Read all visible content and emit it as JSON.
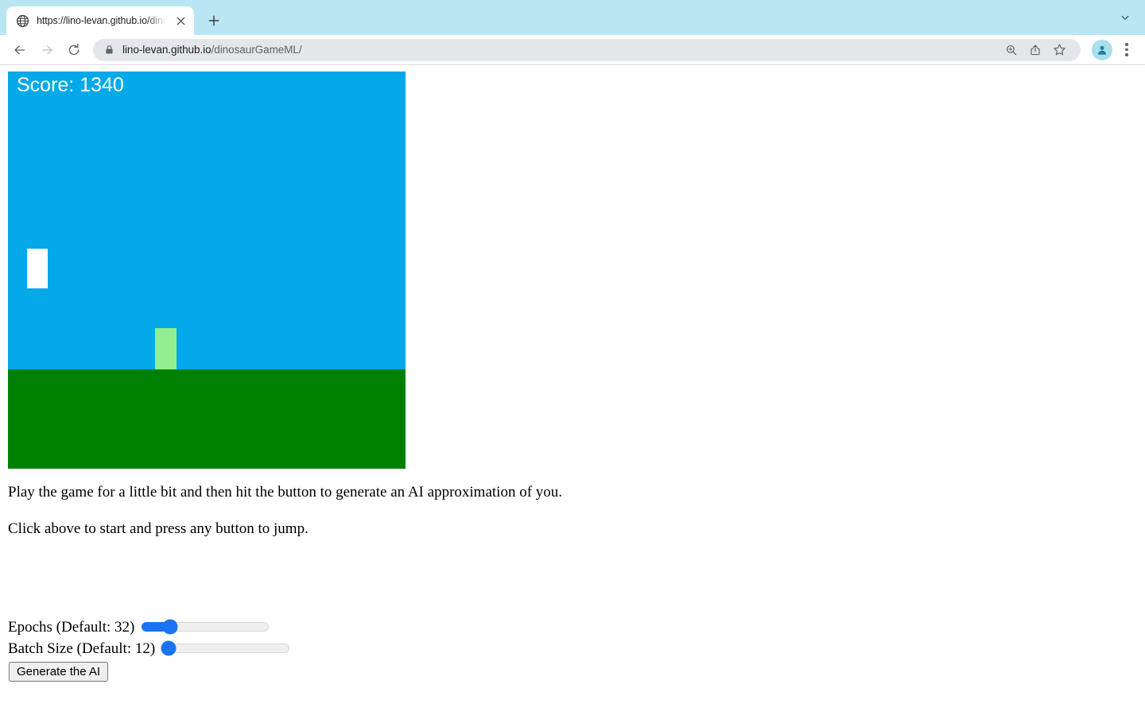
{
  "browser": {
    "tab": {
      "favicon": "globe-icon",
      "title": "https://lino-levan.github.io/dino",
      "close_label": "×"
    },
    "new_tab_label": "+",
    "tabstrip_chevron": "chevron-down-icon",
    "toolbar": {
      "back": "back-arrow-icon",
      "forward": "forward-arrow-icon",
      "reload": "reload-icon",
      "lock": "lock-icon",
      "url_domain": "lino-levan.github.io",
      "url_path": "/dinosaurGameML/",
      "zoom": "zoom-in-icon",
      "share": "share-icon",
      "bookmark": "star-icon",
      "profile": "avatar-icon",
      "menu": "three-dot-menu-icon"
    }
  },
  "game": {
    "score_text": "Score: 1340",
    "score_value": 1340,
    "sky_color": "#03a9e8",
    "ground_color": "#008000",
    "player_color": "#ffffff",
    "obstacle_color": "#90ee90"
  },
  "content": {
    "paragraph_1": "Play the game for a little bit and then hit the button to generate an AI approximation of you.",
    "paragraph_2": "Click above to start and press any button to jump."
  },
  "controls": {
    "epochs": {
      "label": "Epochs (Default: 32)",
      "percent": 22
    },
    "batch_size": {
      "label": "Batch Size (Default: 12)",
      "percent": 5
    },
    "generate_button": "Generate the AI",
    "accent_color": "#1a73f5"
  }
}
